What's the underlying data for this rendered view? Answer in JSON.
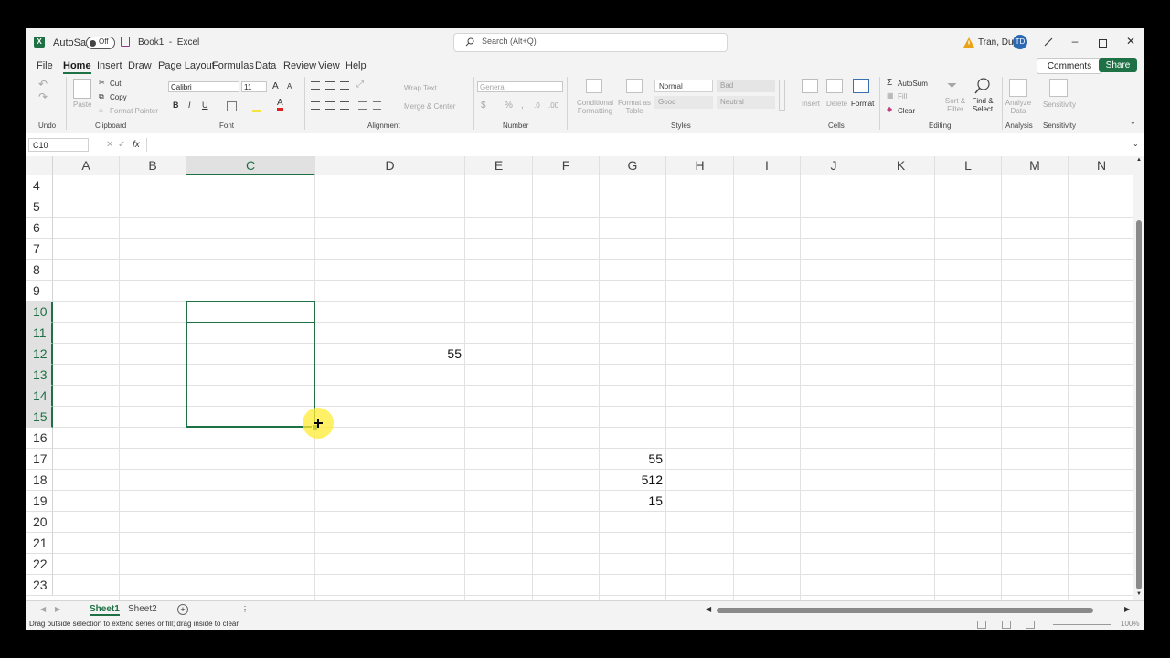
{
  "titlebar": {
    "autosave_label": "AutoSave",
    "autosave_state": "Off",
    "doc_title": "Book1  -  Excel",
    "search_placeholder": "Search (Alt+Q)",
    "user_name": "Tran, Duy",
    "user_initials": "TD"
  },
  "menu": {
    "items": [
      "File",
      "Home",
      "Insert",
      "Draw",
      "Page Layout",
      "Formulas",
      "Data",
      "Review",
      "View",
      "Help"
    ],
    "active": "Home",
    "comments_label": "Comments",
    "share_label": "Share"
  },
  "ribbon": {
    "undo_group": "Undo",
    "clipboard": {
      "paste": "Paste",
      "cut": "Cut",
      "copy": "Copy",
      "format_painter": "Format Painter",
      "group": "Clipboard"
    },
    "font": {
      "name": "Calibri",
      "size": "11",
      "group": "Font",
      "bold": "B",
      "italic": "I",
      "underline": "U",
      "grow": "A",
      "shrink": "A",
      "color_glyph": "A"
    },
    "alignment": {
      "wrap_text": "Wrap Text",
      "merge_center": "Merge & Center",
      "group": "Alignment"
    },
    "number": {
      "format": "General",
      "currency": "$",
      "percent": "%",
      "group": "Number"
    },
    "styles": {
      "conditional": "Conditional Formatting",
      "format_table": "Format as Table",
      "normal": "Normal",
      "bad": "Bad",
      "good": "Good",
      "neutral": "Neutral",
      "group": "Styles"
    },
    "cells": {
      "insert": "Insert",
      "delete": "Delete",
      "format": "Format",
      "group": "Cells"
    },
    "editing": {
      "autosum": "AutoSum",
      "fill": "Fill",
      "clear": "Clear",
      "sort_filter": "Sort & Filter",
      "find_select": "Find & Select",
      "group": "Editing"
    },
    "analysis": {
      "analyze": "Analyze Data",
      "group": "Analysis"
    },
    "sensitivity": {
      "label": "Sensitivity",
      "group": "Sensitivity"
    }
  },
  "formula_bar": {
    "name_box": "C10",
    "fx": "fx",
    "value": ""
  },
  "grid": {
    "columns": [
      "A",
      "B",
      "C",
      "D",
      "E",
      "F",
      "G",
      "H",
      "I",
      "J",
      "K",
      "L",
      "M",
      "N"
    ],
    "selected_column": "C",
    "rows": [
      "4",
      "5",
      "6",
      "7",
      "8",
      "9",
      "10",
      "11",
      "12",
      "13",
      "14",
      "15",
      "16",
      "17",
      "18",
      "19",
      "20",
      "21",
      "22",
      "23"
    ],
    "selected_rows": [
      "10",
      "11",
      "12",
      "13",
      "14",
      "15"
    ],
    "cells": [
      {
        "ref": "D12",
        "value": "55"
      },
      {
        "ref": "G17",
        "value": "55"
      },
      {
        "ref": "G18",
        "value": "512"
      },
      {
        "ref": "G19",
        "value": "15"
      }
    ],
    "selection": "C10:C15",
    "active_cell": "C10"
  },
  "sheets": {
    "tabs": [
      "Sheet1",
      "Sheet2"
    ],
    "active": "Sheet1"
  },
  "status_bar": {
    "message": "Drag outside selection to extend series or fill; drag inside to clear",
    "zoom": "100%"
  }
}
